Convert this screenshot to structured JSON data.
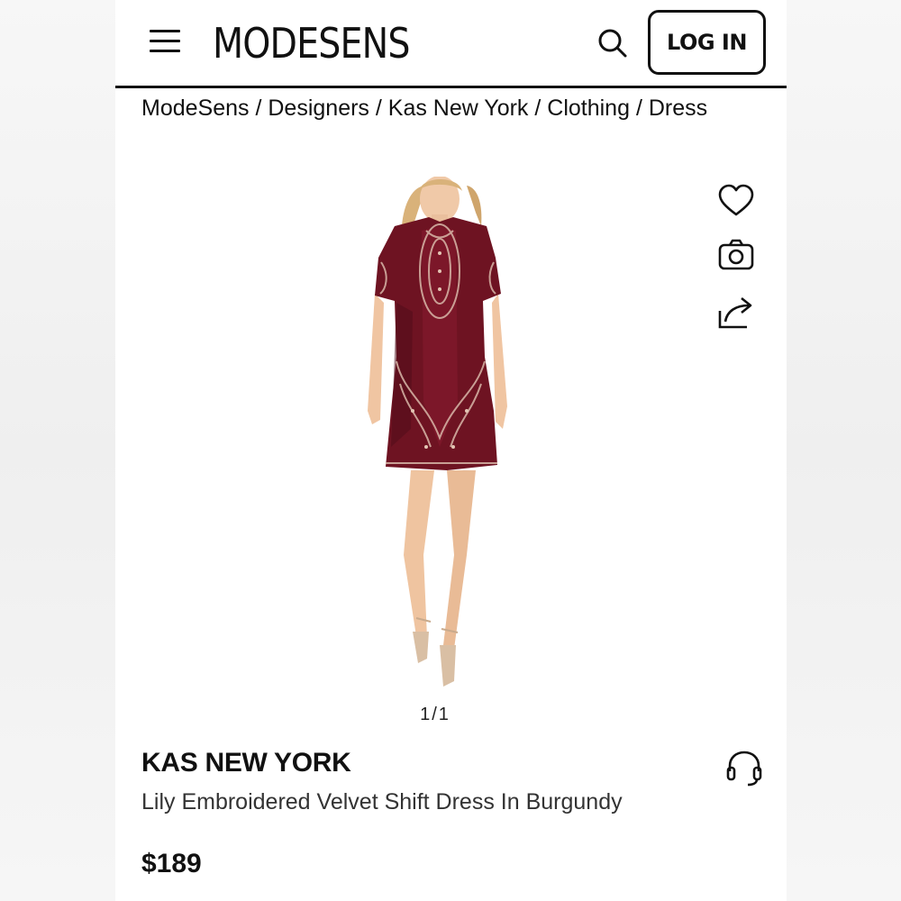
{
  "header": {
    "logo": "MODESENS",
    "login_label": "LOG IN"
  },
  "breadcrumb": [
    {
      "label": "ModeSens"
    },
    {
      "label": "Designers"
    },
    {
      "label": "Kas New York"
    },
    {
      "label": "Clothing"
    },
    {
      "label": "Dress"
    }
  ],
  "breadcrumb_separator": " / ",
  "gallery": {
    "counter": "1/1"
  },
  "product": {
    "brand": "KAS NEW YORK",
    "title": "Lily Embroidered Velvet Shift Dress In Burgundy",
    "price": "$189",
    "dress_color": "#6e1322"
  },
  "icons": {
    "menu": "menu-icon",
    "search": "search-icon",
    "wishlist": "heart-icon",
    "camera": "camera-icon",
    "share": "share-icon",
    "support": "headset-icon"
  }
}
